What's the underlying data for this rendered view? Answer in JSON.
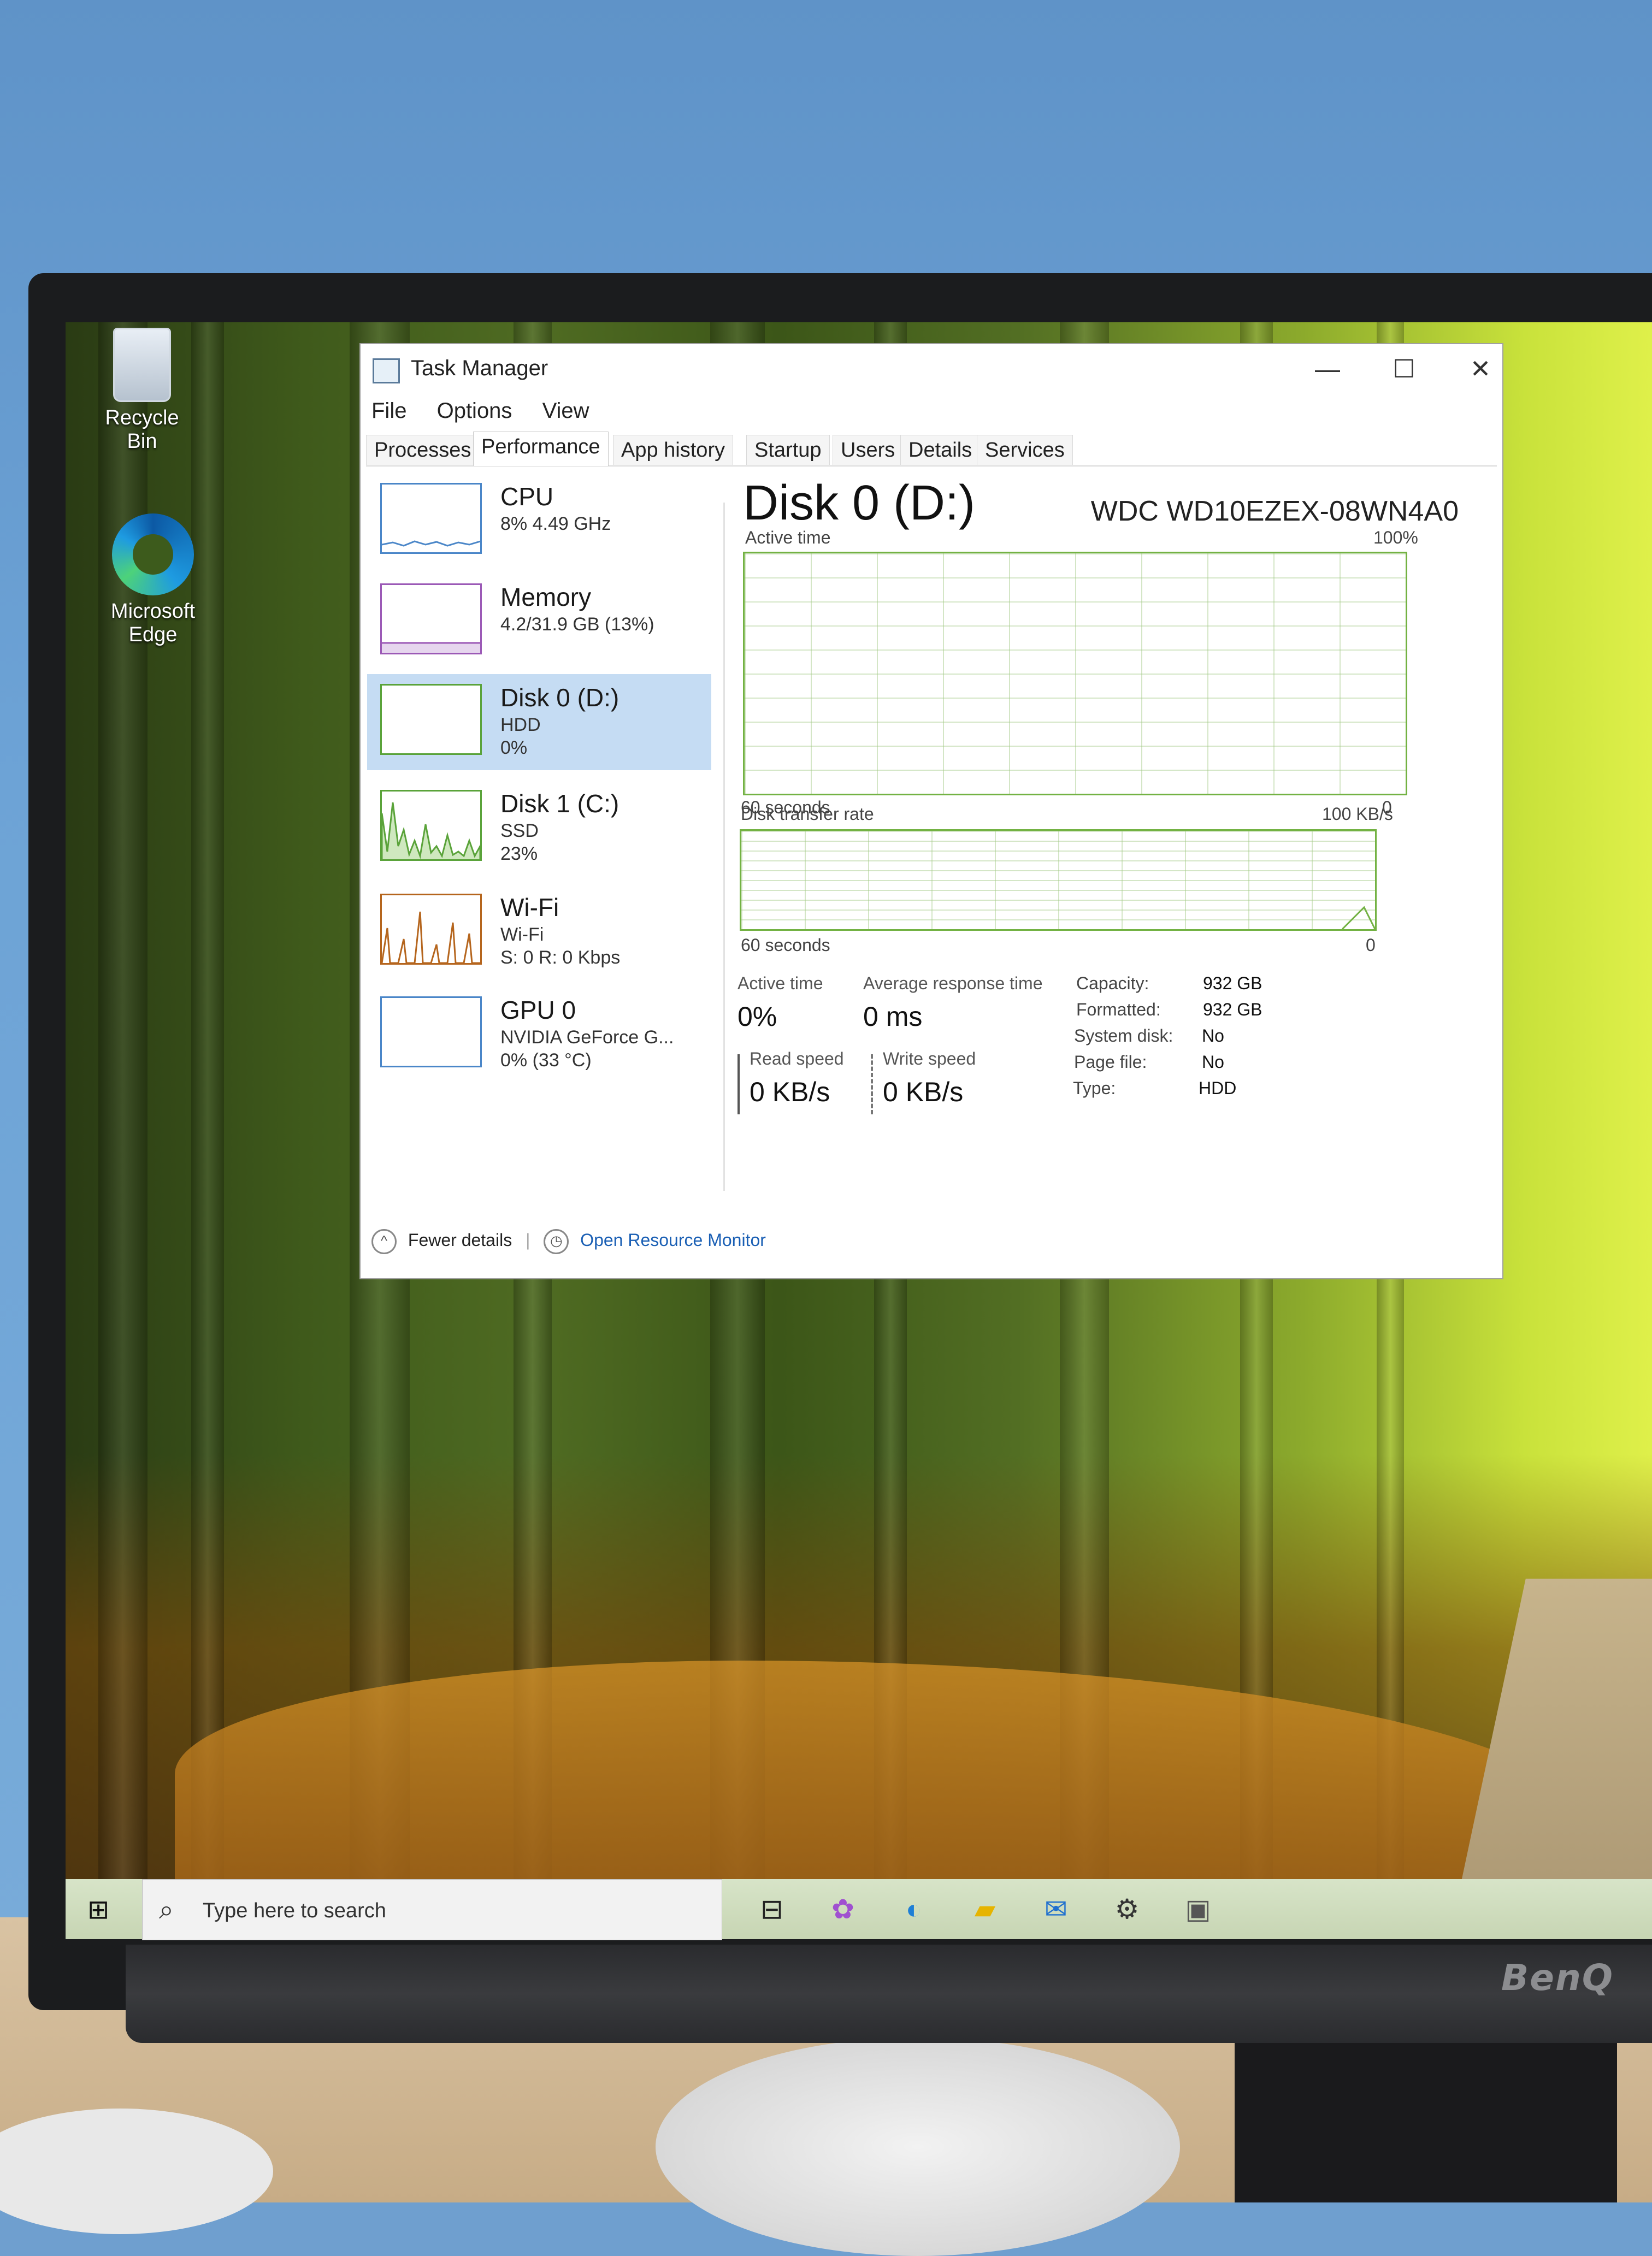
{
  "desktop": {
    "icons": [
      {
        "label": "Recycle Bin"
      },
      {
        "label": "Microsoft Edge"
      }
    ]
  },
  "task_manager": {
    "title": "Task Manager",
    "window_controls": {
      "minimize": "—",
      "maximize": "☐",
      "close": "✕"
    },
    "menu": [
      "File",
      "Options",
      "View"
    ],
    "tabs": [
      "Processes",
      "Performance",
      "App history",
      "Startup",
      "Users",
      "Details",
      "Services"
    ],
    "active_tab": "Performance",
    "sidebar": [
      {
        "name": "CPU",
        "line2": "8% 4.49 GHz",
        "line3": ""
      },
      {
        "name": "Memory",
        "line2": "4.2/31.9 GB (13%)",
        "line3": ""
      },
      {
        "name": "Disk 0 (D:)",
        "line2": "HDD",
        "line3": "0%"
      },
      {
        "name": "Disk 1 (C:)",
        "line2": "SSD",
        "line3": "23%"
      },
      {
        "name": "Wi-Fi",
        "line2": "Wi-Fi",
        "line3": "S: 0 R: 0 Kbps"
      },
      {
        "name": "GPU 0",
        "line2": "NVIDIA GeForce G...",
        "line3": "0% (33 °C)"
      }
    ],
    "selected_item": "Disk 0 (D:)",
    "main": {
      "title": "Disk 0 (D:)",
      "model": "WDC WD10EZEX-08WN4A0",
      "active_time_graph": {
        "label": "Active time",
        "max": "100%",
        "x_left": "60 seconds",
        "x_right": "0"
      },
      "transfer_graph": {
        "label": "Disk transfer rate",
        "max": "100 KB/s",
        "x_left": "60 seconds",
        "x_right": "0"
      },
      "stats": {
        "active_time_label": "Active time",
        "active_time_value": "0%",
        "avg_response_label": "Average response time",
        "avg_response_value": "0 ms",
        "read_speed_label": "Read speed",
        "read_speed_value": "0 KB/s",
        "write_speed_label": "Write speed",
        "write_speed_value": "0 KB/s"
      },
      "properties": [
        {
          "key": "Capacity:",
          "value": "932 GB"
        },
        {
          "key": "Formatted:",
          "value": "932 GB"
        },
        {
          "key": "System disk:",
          "value": "No"
        },
        {
          "key": "Page file:",
          "value": "No"
        },
        {
          "key": "Type:",
          "value": "HDD"
        }
      ]
    },
    "footer": {
      "fewer_details": "Fewer details",
      "open_resource_monitor": "Open Resource Monitor"
    }
  },
  "taskbar": {
    "search_placeholder": "Type here to search",
    "icons": [
      "task-view",
      "copilot",
      "edge",
      "file-explorer",
      "mail",
      "settings",
      "photos"
    ]
  },
  "monitor": {
    "brand": "BenQ"
  },
  "colors": {
    "graph_green": "#73b243",
    "selection_blue": "#c5dcf3",
    "link_blue": "#1a5fb4"
  }
}
